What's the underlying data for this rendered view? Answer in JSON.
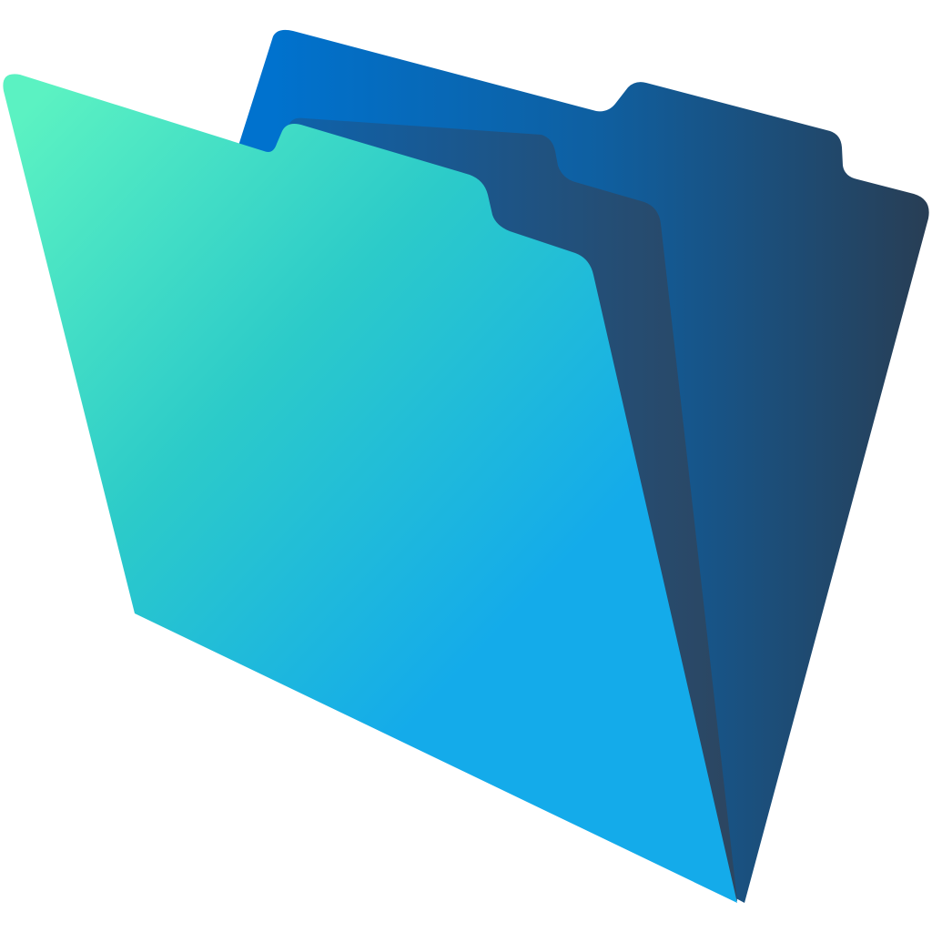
{
  "icon": {
    "name": "folder-icon",
    "colors": {
      "back_light": "#0072CE",
      "back_mid": "#0F5FA0",
      "back_dark": "#283E55",
      "middle_light": "#0F62AA",
      "middle_dark": "#2C4661",
      "front_light": "#5BF2C2",
      "front_mid": "#2CCBC9",
      "front_dark": "#14ABEA"
    }
  }
}
